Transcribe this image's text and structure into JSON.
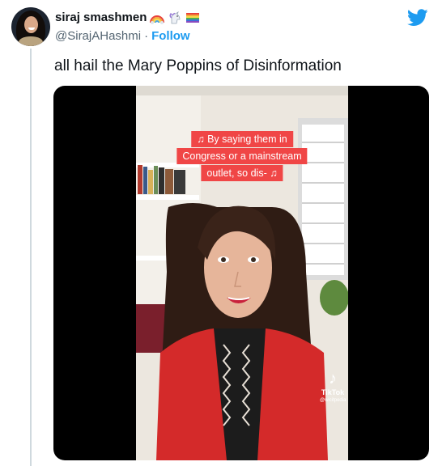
{
  "author": {
    "display_name": "siraj smashmen",
    "handle": "@SirajAHashmi",
    "separator": "·",
    "follow_label": "Follow",
    "name_emojis": [
      "rainbow-emoji",
      "unicorn-emoji",
      "rainbow-flag-emoji"
    ]
  },
  "tweet": {
    "text": "all hail the Mary Poppins of Disinformation"
  },
  "video": {
    "captions": [
      "♫ By saying them in",
      "Congress or a mainstream",
      "outlet, so dis- ♫"
    ],
    "watermark_brand": "TikTok",
    "watermark_user": "@wicitpedia"
  },
  "colors": {
    "accent": "#1d9bf0",
    "caption_bg": "#f04646",
    "text_primary": "#0f1419",
    "text_secondary": "#536471"
  },
  "icons": {
    "platform": "twitter-bird-icon",
    "watermark": "tiktok-logo-icon"
  }
}
